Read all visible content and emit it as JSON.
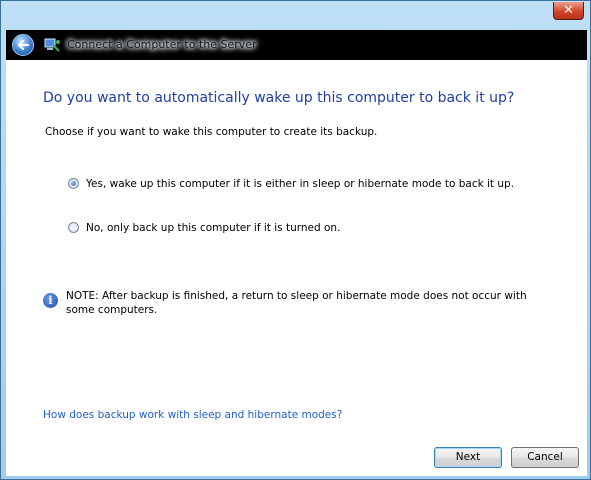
{
  "window": {
    "title": "Connect a Computer to the Server",
    "close_glyph": "✕",
    "back_icon": "back-arrow-icon",
    "app_icon": "network-computer-icon"
  },
  "main": {
    "heading": "Do you want to automatically wake up this computer to back it up?",
    "subtext": "Choose if you want to wake this computer to create its backup.",
    "options": [
      {
        "label": "Yes, wake up this computer if it is either in sleep or hibernate mode to back it up.",
        "checked": true
      },
      {
        "label": "No, only back up this computer if it is turned on.",
        "checked": false
      }
    ],
    "note": {
      "icon": "info-icon",
      "glyph": "i",
      "text": "NOTE: After backup is finished, a return to sleep or hibernate mode does not occur with some computers."
    },
    "help_link": "How does backup work with sleep and hibernate modes?"
  },
  "buttons": {
    "next_label": "Next",
    "cancel_label": "Cancel"
  },
  "colors": {
    "heading": "#1f3fa0",
    "link": "#1f5fc6",
    "title_bar": "#000000",
    "frame": "#9fcdef",
    "close": "#d2472b"
  }
}
